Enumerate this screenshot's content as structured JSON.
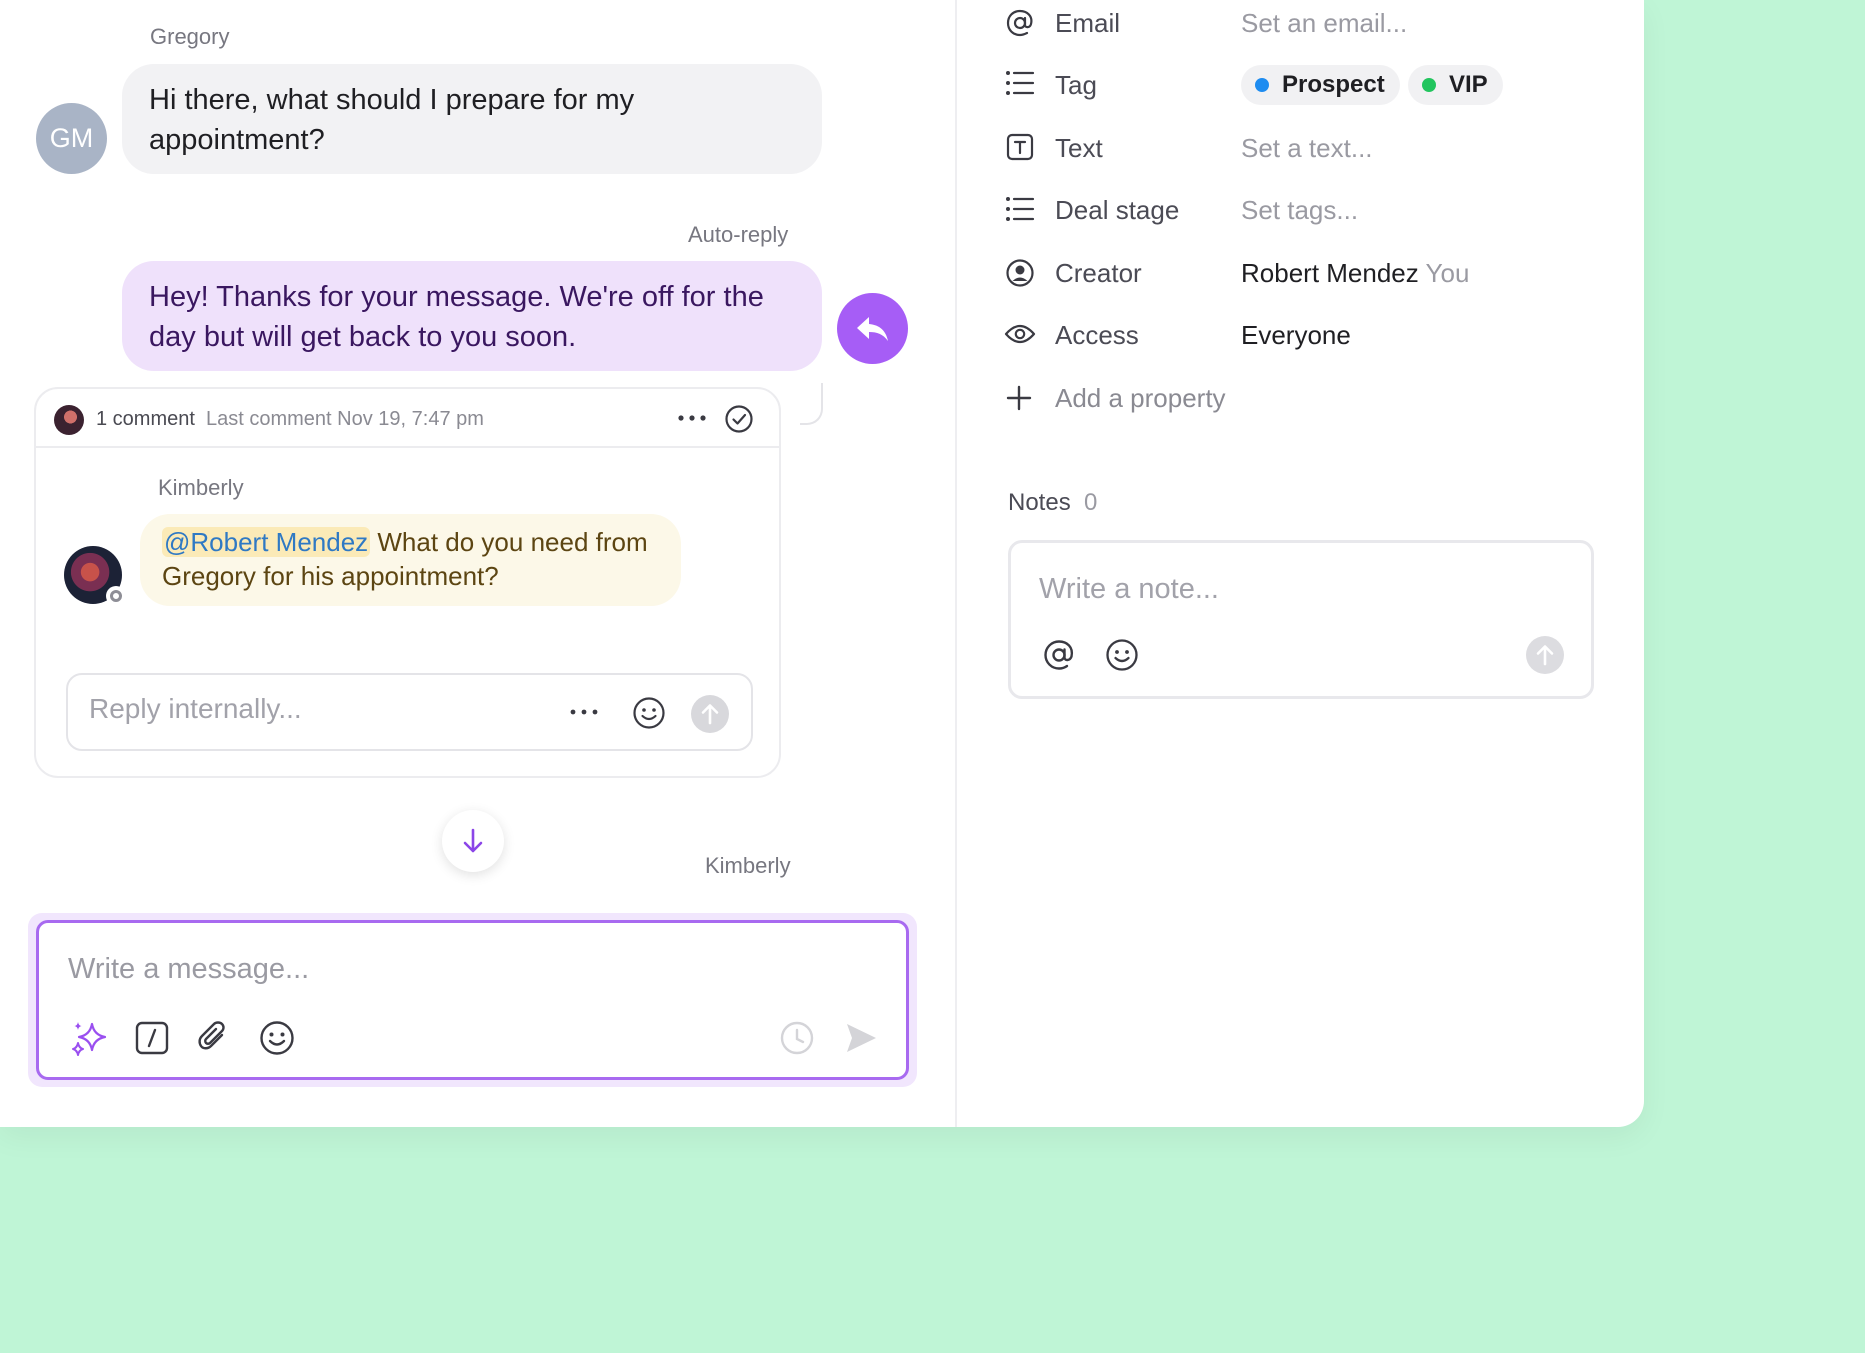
{
  "chat": {
    "incoming": {
      "sender": "Gregory",
      "avatar_initials": "GM",
      "text": "Hi there, what should I prepare for my appointment?"
    },
    "auto_reply": {
      "label": "Auto-reply",
      "text": "Hey! Thanks for your message. We're off for the day but will get back to you soon."
    },
    "thread": {
      "comment_count": "1 comment",
      "last_comment": "Last comment Nov 19, 7:47 pm",
      "author": "Kimberly",
      "mention": "@Robert Mendez",
      "comment_text": " What do you need from Gregory for his appointment?",
      "reply_placeholder": "Reply internally..."
    },
    "typing_user": "Kimberly",
    "composer_placeholder": "Write a message..."
  },
  "properties": [
    {
      "icon": "at-icon",
      "label": "Email",
      "value": "Set an email..."
    },
    {
      "icon": "list-icon",
      "label": "Tag"
    },
    {
      "icon": "text-icon",
      "label": "Text",
      "value": "Set a text..."
    },
    {
      "icon": "list-icon",
      "label": "Deal stage",
      "value": "Set tags..."
    },
    {
      "icon": "user-circle-icon",
      "label": "Creator",
      "value": "Robert Mendez",
      "value_suffix": "You"
    },
    {
      "icon": "eye-icon",
      "label": "Access",
      "value": "Everyone"
    }
  ],
  "tags": [
    {
      "label": "Prospect",
      "color": "#1e8cf0"
    },
    {
      "label": "VIP",
      "color": "#22c55e"
    }
  ],
  "add_property_label": "Add a property",
  "notes": {
    "title": "Notes",
    "count": "0",
    "placeholder": "Write a note..."
  },
  "colors": {
    "background": "#bff5d6",
    "accent": "#a65df6",
    "auto_reply_bubble": "#efe1fb",
    "comment_bubble": "#fcf8e8"
  }
}
